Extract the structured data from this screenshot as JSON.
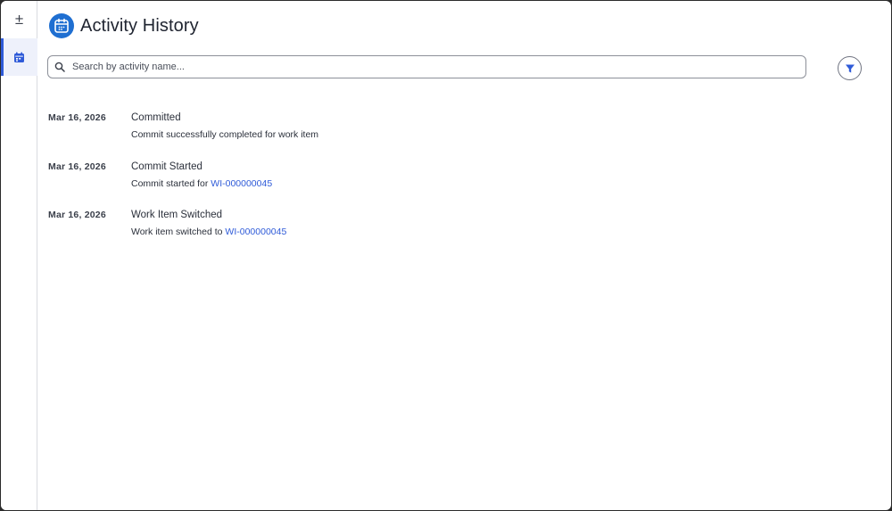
{
  "rail": {
    "items": [
      {
        "icon": "plus-minus-icon",
        "label": "±"
      },
      {
        "icon": "calendar-icon",
        "active": true
      }
    ]
  },
  "header": {
    "icon": "calendar-icon",
    "title": "Activity History"
  },
  "search": {
    "icon": "search-icon",
    "placeholder": "Search by activity name...",
    "value": ""
  },
  "filter": {
    "icon": "filter-icon"
  },
  "colors": {
    "accent": "#2f5bd8",
    "header_icon_bg": "#1f6fd1",
    "link": "#2f5bd8"
  },
  "activities": [
    {
      "date": "Mar 16, 2026",
      "name": "Committed",
      "desc_text": "Commit successfully completed for work item",
      "link": ""
    },
    {
      "date": "Mar 16, 2026",
      "name": "Commit Started",
      "desc_text": "Commit started for ",
      "link": "WI-000000045"
    },
    {
      "date": "Mar 16, 2026",
      "name": "Work Item Switched",
      "desc_text": "Work item switched to ",
      "link": "WI-000000045"
    }
  ]
}
